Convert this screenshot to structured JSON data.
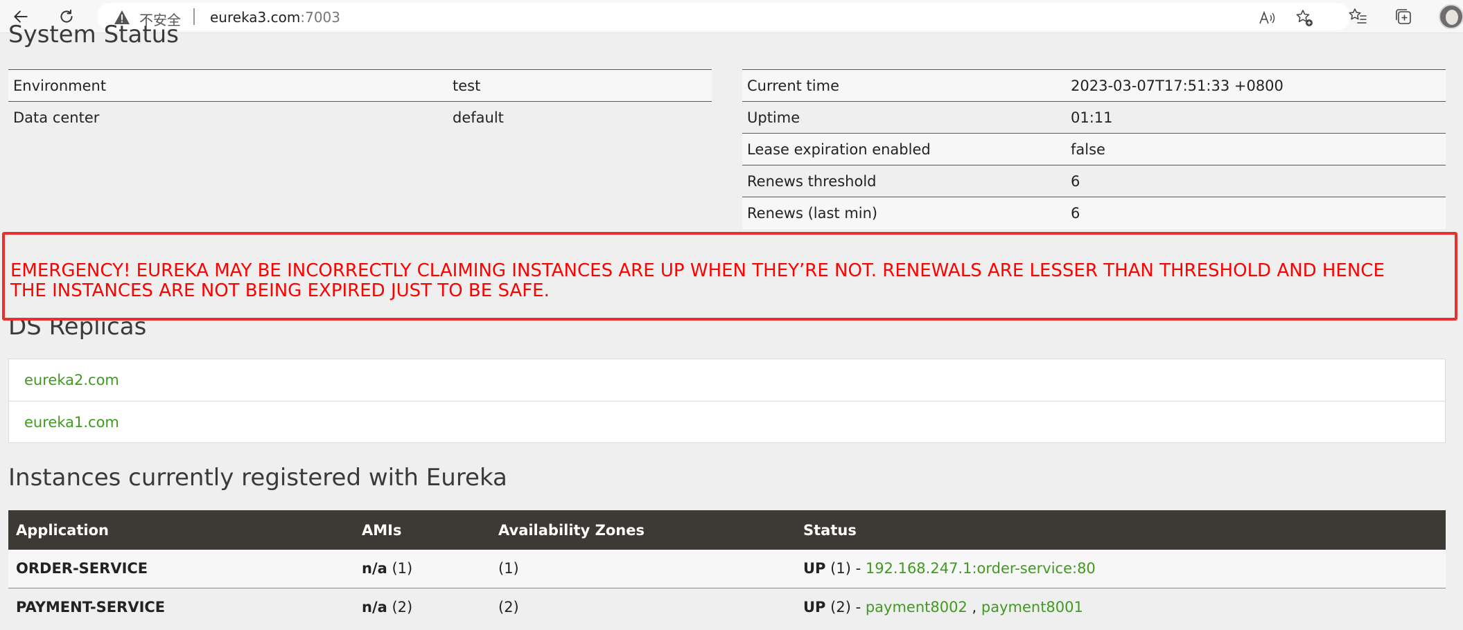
{
  "browser": {
    "insecure_label": "不安全",
    "url_host": "eureka3.com",
    "url_port": ":7003"
  },
  "system_status": {
    "title": "System Status",
    "left_rows": [
      {
        "label": "Environment",
        "value": "test"
      },
      {
        "label": "Data center",
        "value": "default"
      }
    ],
    "right_rows": [
      {
        "label": "Current time",
        "value": "2023-03-07T17:51:33 +0800"
      },
      {
        "label": "Uptime",
        "value": "01:11"
      },
      {
        "label": "Lease expiration enabled",
        "value": "false"
      },
      {
        "label": "Renews threshold",
        "value": "6"
      },
      {
        "label": "Renews (last min)",
        "value": "6"
      }
    ]
  },
  "emergency": {
    "line1": "EMERGENCY! EUREKA MAY BE INCORRECTLY CLAIMING INSTANCES ARE UP WHEN THEY’RE NOT. RENEWALS ARE LESSER THAN THRESHOLD AND HENCE",
    "line2": "THE INSTANCES ARE NOT BEING EXPIRED JUST TO BE SAFE.",
    "color": "#ff0000"
  },
  "ds_replicas": {
    "title": "DS Replicas",
    "items": [
      "eureka2.com",
      "eureka1.com"
    ]
  },
  "instances": {
    "title": "Instances currently registered with Eureka",
    "columns": [
      "Application",
      "AMIs",
      "Availability Zones",
      "Status"
    ],
    "rows": [
      {
        "application": "ORDER-SERVICE",
        "ami_label": "n/a",
        "ami_count": "(1)",
        "zones": "(1)",
        "status_label": "UP",
        "status_count": "(1) -",
        "links": [
          "192.168.247.1:order-service:80"
        ]
      },
      {
        "application": "PAYMENT-SERVICE",
        "ami_label": "n/a",
        "ami_count": "(2)",
        "zones": "(2)",
        "status_label": "UP",
        "status_count": "(2) -",
        "links": [
          "payment8002",
          "payment8001"
        ],
        "link_separator": ","
      }
    ]
  },
  "colors": {
    "link": "#3f9a1f",
    "table_header": "#3d3935",
    "alert_border": "#e8302e"
  }
}
